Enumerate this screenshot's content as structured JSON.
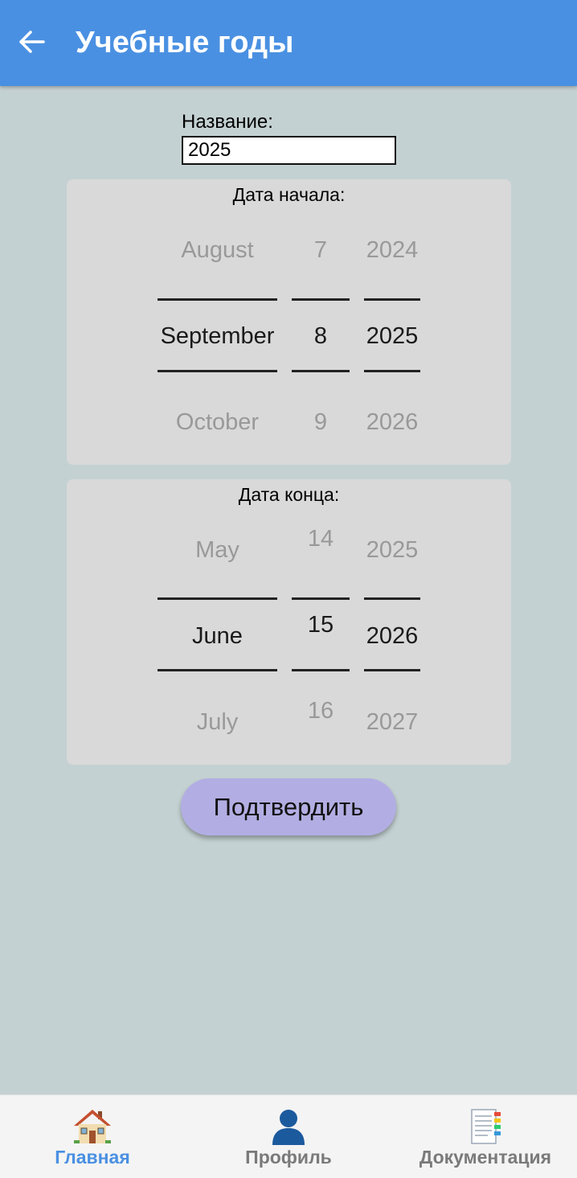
{
  "header": {
    "title": "Учебные годы",
    "back_icon": "arrow-left-icon",
    "bar_color": "#4a90e2"
  },
  "form": {
    "name_label": "Название:",
    "name_value": "2025",
    "confirm_label": "Подтвердить",
    "confirm_color": "#b2aee3"
  },
  "start_date": {
    "title": "Дата начала:",
    "month": {
      "prev": "August",
      "selected": "September",
      "next": "October"
    },
    "day": {
      "prev": "7",
      "selected": "8",
      "next": "9"
    },
    "year": {
      "prev": "2024",
      "selected": "2025",
      "next": "2026"
    }
  },
  "end_date": {
    "title": "Дата конца:",
    "month": {
      "prev": "May",
      "selected": "June",
      "next": "July"
    },
    "day": {
      "prev": "14",
      "selected": "15",
      "next": "16"
    },
    "year": {
      "prev": "2025",
      "selected": "2026",
      "next": "2027"
    }
  },
  "nav": {
    "items": [
      {
        "label": "Главная",
        "icon": "home-icon",
        "active": true
      },
      {
        "label": "Профиль",
        "icon": "profile-icon",
        "active": false
      },
      {
        "label": "Документация",
        "icon": "documents-icon",
        "active": false
      }
    ],
    "active_color": "#4a90e2"
  }
}
